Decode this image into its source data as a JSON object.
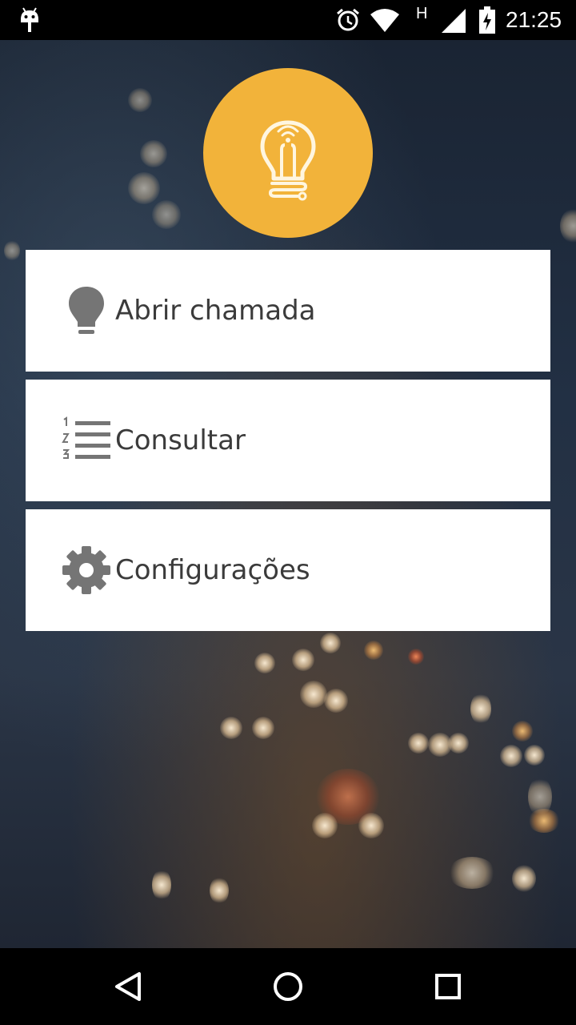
{
  "status_bar": {
    "network_type": "H",
    "time": "21:25"
  },
  "menu": {
    "items": [
      {
        "label": "Abrir chamada",
        "icon": "lightbulb-icon"
      },
      {
        "label": "Consultar",
        "icon": "numbered-list-icon"
      },
      {
        "label": "Configurações",
        "icon": "gear-icon"
      }
    ]
  },
  "nav_bar": {
    "back": "back-icon",
    "home": "home-icon",
    "recents": "recents-icon"
  },
  "colors": {
    "logo_background": "#F2B33A",
    "card_background": "#FFFFFF",
    "icon_gray": "#757575",
    "label_text": "#3B3B3B"
  }
}
